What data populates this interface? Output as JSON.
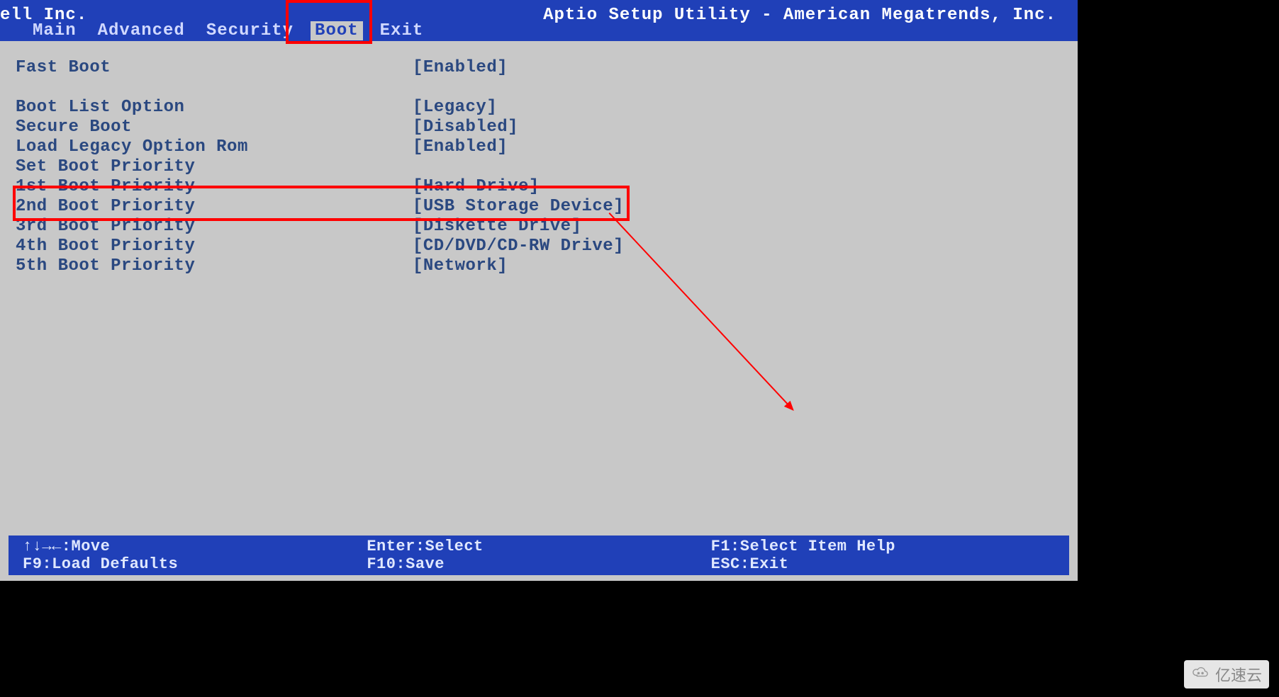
{
  "header": {
    "vendor": "ell Inc.",
    "title": "Aptio Setup Utility - American Megatrends, Inc.",
    "tabs": [
      {
        "label": "Main",
        "active": false
      },
      {
        "label": "Advanced",
        "active": false
      },
      {
        "label": "Security",
        "active": false
      },
      {
        "label": "Boot",
        "active": true
      },
      {
        "label": "Exit",
        "active": false
      }
    ]
  },
  "settings": [
    {
      "label": "Fast Boot",
      "value": "[Enabled]"
    },
    {
      "label": "",
      "value": ""
    },
    {
      "label": "Boot List Option",
      "value": "[Legacy]"
    },
    {
      "label": "Secure Boot",
      "value": "[Disabled]"
    },
    {
      "label": "Load Legacy Option Rom",
      "value": "[Enabled]"
    },
    {
      "label": "Set Boot Priority",
      "value": ""
    },
    {
      "label": "1st Boot Priority",
      "value": "[Hard Drive]"
    },
    {
      "label": "2nd Boot Priority",
      "value": "[USB Storage Device]"
    },
    {
      "label": "3rd Boot Priority",
      "value": "[Diskette Drive]"
    },
    {
      "label": "4th Boot Priority",
      "value": "[CD/DVD/CD-RW Drive]"
    },
    {
      "label": "5th Boot Priority",
      "value": "[Network]"
    }
  ],
  "footer": {
    "row1": {
      "c1": "↑↓→←:Move",
      "c2": "Enter:Select",
      "c3": "F1:Select Item Help"
    },
    "row2": {
      "c1": "F9:Load Defaults",
      "c2": "F10:Save",
      "c3": "ESC:Exit"
    }
  },
  "watermark": {
    "text": "亿速云"
  },
  "annotations": {
    "highlighted_tab": "Boot",
    "highlighted_row_index": 7,
    "arrow_target": "2nd Boot Priority = [USB Storage Device]"
  }
}
